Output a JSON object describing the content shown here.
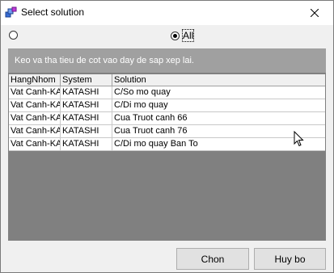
{
  "window": {
    "title": "Select solution"
  },
  "radios": [
    {
      "label": "",
      "selected": false
    },
    {
      "label": "All",
      "selected": true
    }
  ],
  "group_panel": {
    "text": "Keo va tha tieu de cot vao day de sap xep lai."
  },
  "table": {
    "columns": [
      "HangNhom",
      "System",
      "Solution"
    ],
    "rows": [
      [
        "Vat Canh-KA",
        "KATASHI",
        "C/So mo quay"
      ],
      [
        "Vat Canh-KA",
        "KATASHI",
        "C/Di mo quay"
      ],
      [
        "Vat Canh-KA",
        "KATASHI",
        "Cua Truot canh 66"
      ],
      [
        "Vat Canh-KA",
        "KATASHI",
        "Cua Truot canh 76"
      ],
      [
        "Vat Canh-KA",
        "KATASHI",
        "C/Di mo quay Ban To"
      ]
    ]
  },
  "buttons": {
    "ok": "Chon",
    "cancel": "Huy bo"
  }
}
